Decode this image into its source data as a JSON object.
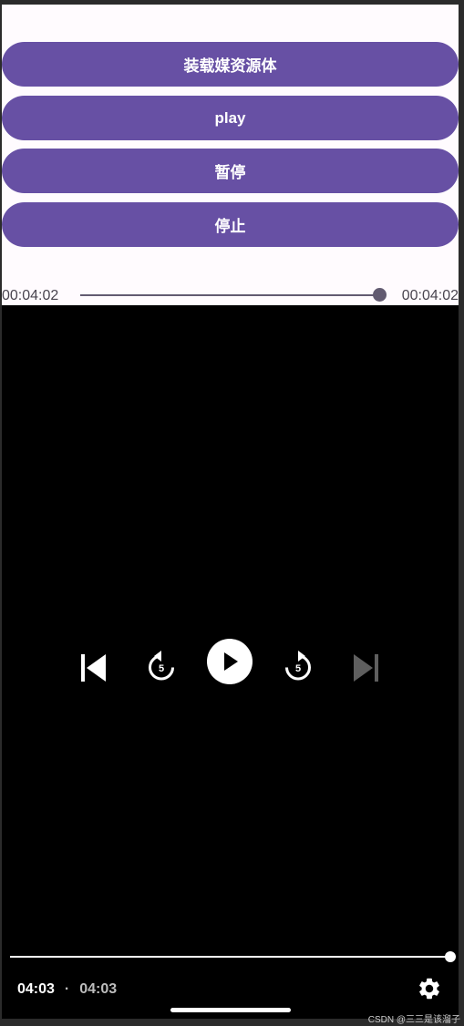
{
  "buttons": {
    "load": "装载媒资源体",
    "play": "play",
    "pause": "暂停",
    "stop": "停止"
  },
  "seek": {
    "position": "00:04:02",
    "duration": "00:04:02",
    "progress": 1.0
  },
  "player": {
    "controls": {
      "previous": "skip-previous-icon",
      "rewind": "replay-5-icon",
      "rewind_seconds": "5",
      "play": "play-icon",
      "fast_forward": "forward-5-icon",
      "forward_seconds": "5",
      "next": "skip-next-icon"
    },
    "current_time": "04:03",
    "separator": "·",
    "duration": "04:03",
    "progress": 1.0,
    "settings_icon": "gear-icon"
  },
  "watermark": "CSDN @三三是该溜子",
  "colors": {
    "accent": "#6750a4",
    "slider": "#625b71",
    "player_bg": "#000000",
    "disabled_icon": "#5f5f5f"
  }
}
